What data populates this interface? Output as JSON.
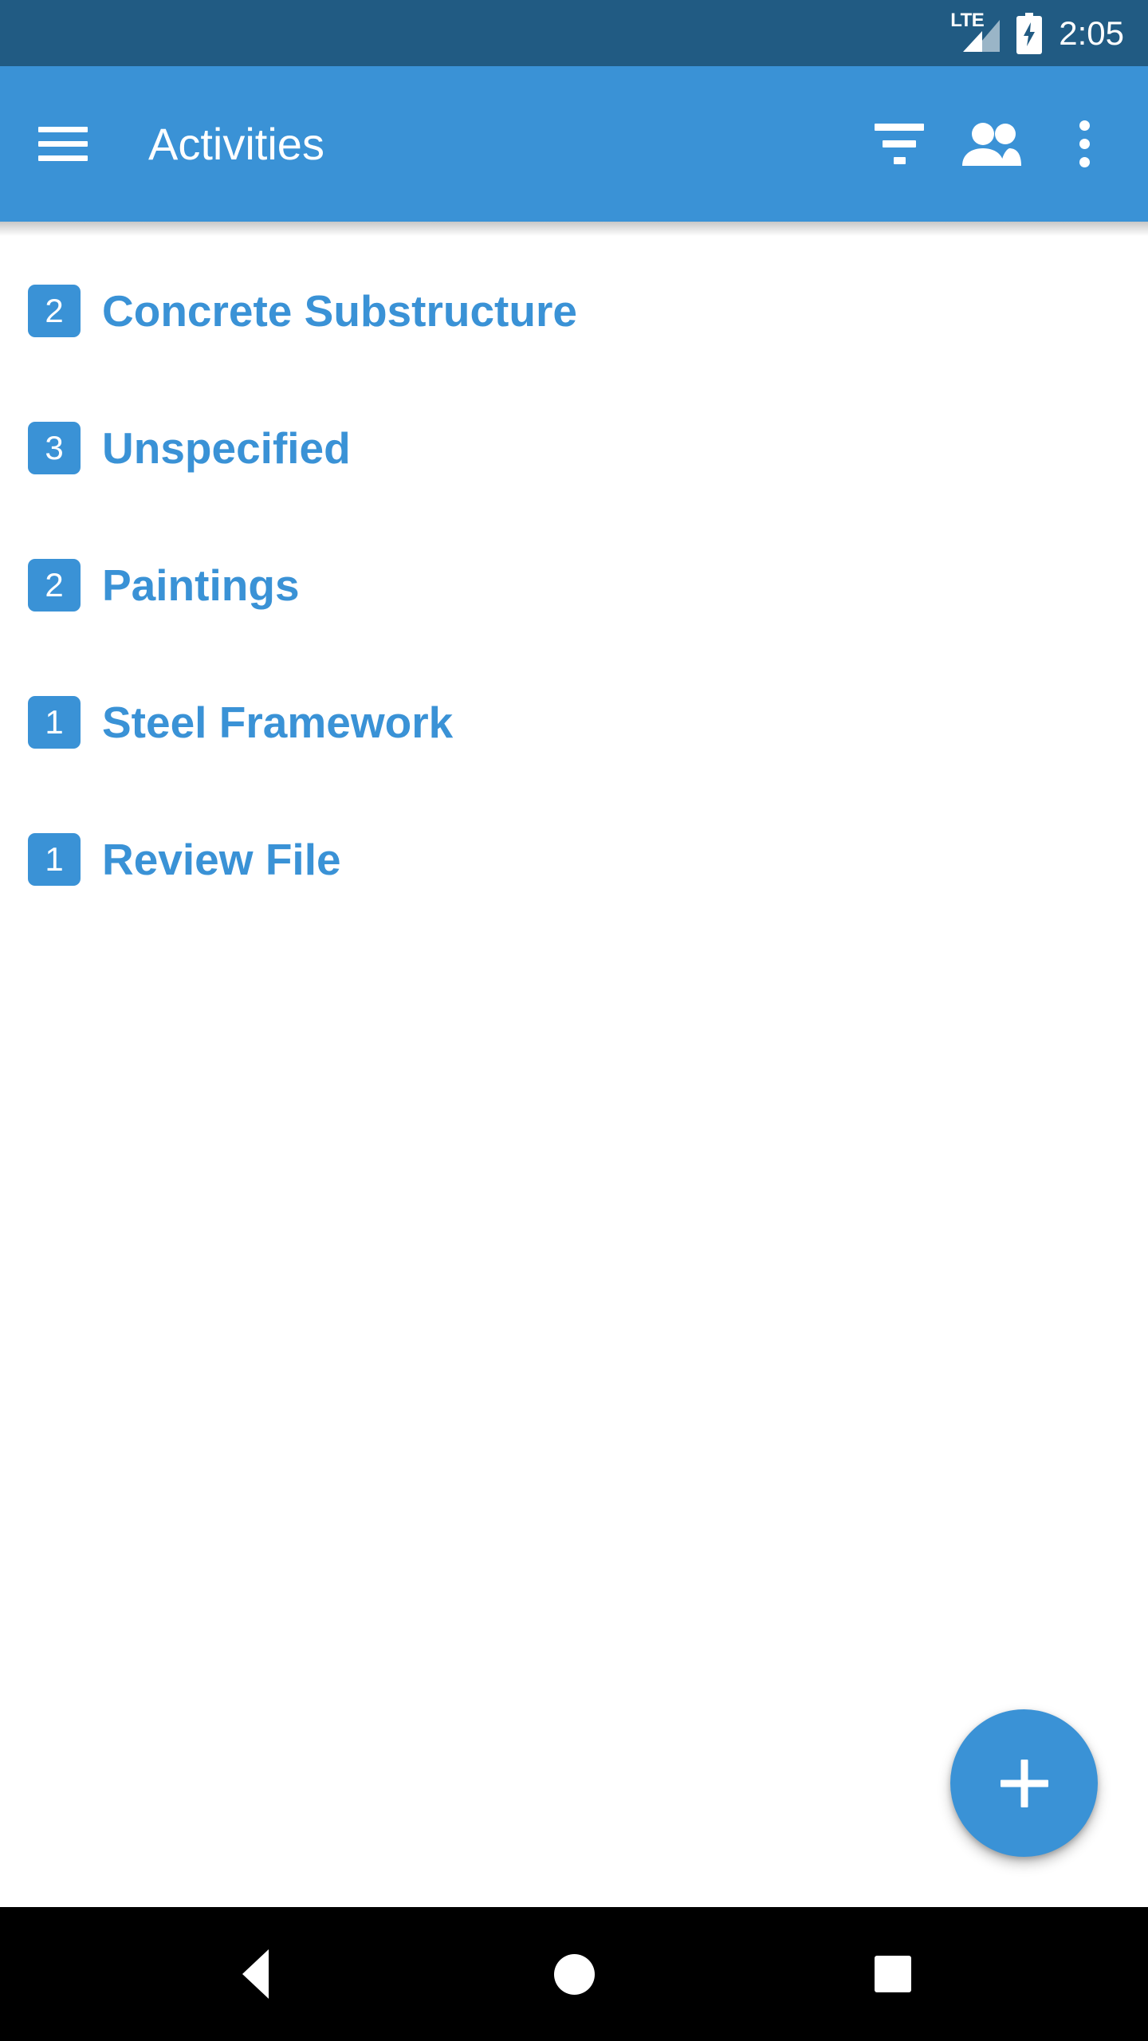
{
  "status_bar": {
    "network_label": "LTE",
    "network_icon": "signal-cellular-icon",
    "battery_icon": "battery-charging-icon",
    "time": "2:05",
    "background_color": "#215b83"
  },
  "app_bar": {
    "menu_icon": "hamburger-menu-icon",
    "title": "Activities",
    "background_color": "#3a92d6",
    "actions": [
      {
        "name": "filter-icon",
        "label": "Filter"
      },
      {
        "name": "people-icon",
        "label": "People"
      },
      {
        "name": "more-vert-icon",
        "label": "More options"
      }
    ]
  },
  "list": {
    "accent_color": "#3a92d6",
    "items": [
      {
        "count": "2",
        "label": "Concrete Substructure"
      },
      {
        "count": "3",
        "label": "Unspecified"
      },
      {
        "count": "2",
        "label": "Paintings"
      },
      {
        "count": "1",
        "label": "Steel Framework"
      },
      {
        "count": "1",
        "label": "Review File"
      }
    ]
  },
  "fab": {
    "icon": "plus-icon",
    "label": "Add activity",
    "color": "#3a92d6"
  },
  "nav_bar": {
    "background_color": "#000000",
    "buttons": [
      {
        "name": "nav-back-button",
        "label": "Back"
      },
      {
        "name": "nav-home-button",
        "label": "Home"
      },
      {
        "name": "nav-recents-button",
        "label": "Recents"
      }
    ]
  }
}
